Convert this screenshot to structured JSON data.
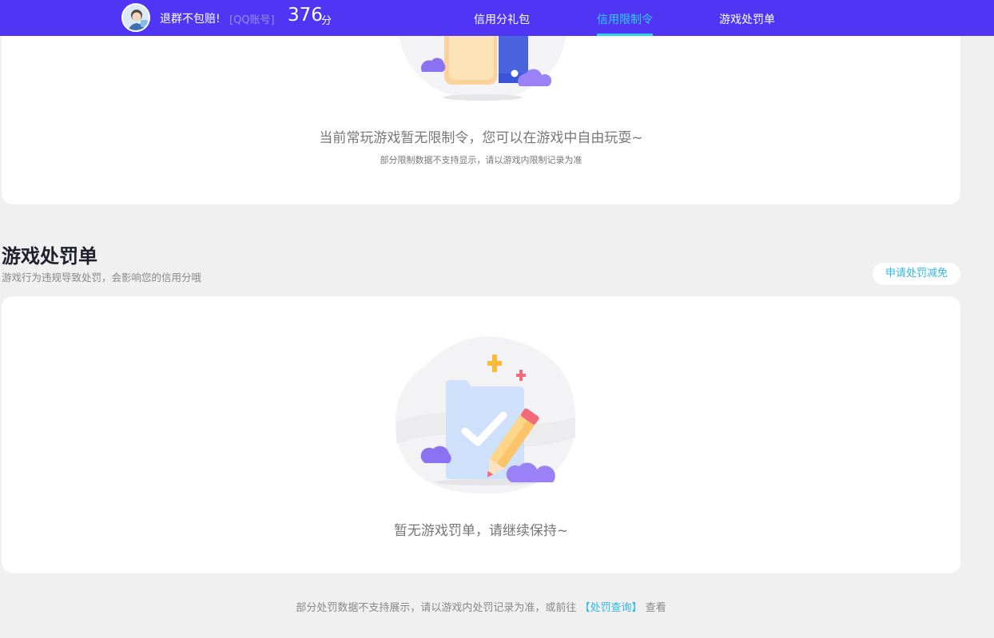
{
  "header": {
    "nickname": "退群不包赔!",
    "account_type": "[QQ账号]",
    "score": "376",
    "score_unit": "分",
    "tabs": [
      {
        "label": "信用分礼包",
        "active": false
      },
      {
        "label": "信用限制令",
        "active": true
      },
      {
        "label": "游戏处罚单",
        "active": false
      }
    ],
    "bar_color": "#5135f5",
    "active_color": "#2fd0f0"
  },
  "restriction": {
    "empty_message": "当前常玩游戏暂无限制令，您可以在游戏中自由玩耍~",
    "note": "部分限制数据不支持显示，请以游戏内限制记录为准"
  },
  "penalty": {
    "title": "游戏处罚单",
    "subtitle": "游戏行为违规导致处罚，会影响您的信用分哦",
    "reduce_button": "申请处罚减免",
    "empty_message": "暂无游戏罚单，请继续保持~"
  },
  "footer": {
    "text_before": "部分处罚数据不支持展示，请以游戏内处罚记录为准，或前往",
    "link": "【处罚查询】",
    "text_after": "查看"
  },
  "icons": {
    "avatar": "user-avatar",
    "restriction_illustration": "thumbs-up-card-illustration",
    "penalty_illustration": "document-check-pencil-illustration"
  }
}
